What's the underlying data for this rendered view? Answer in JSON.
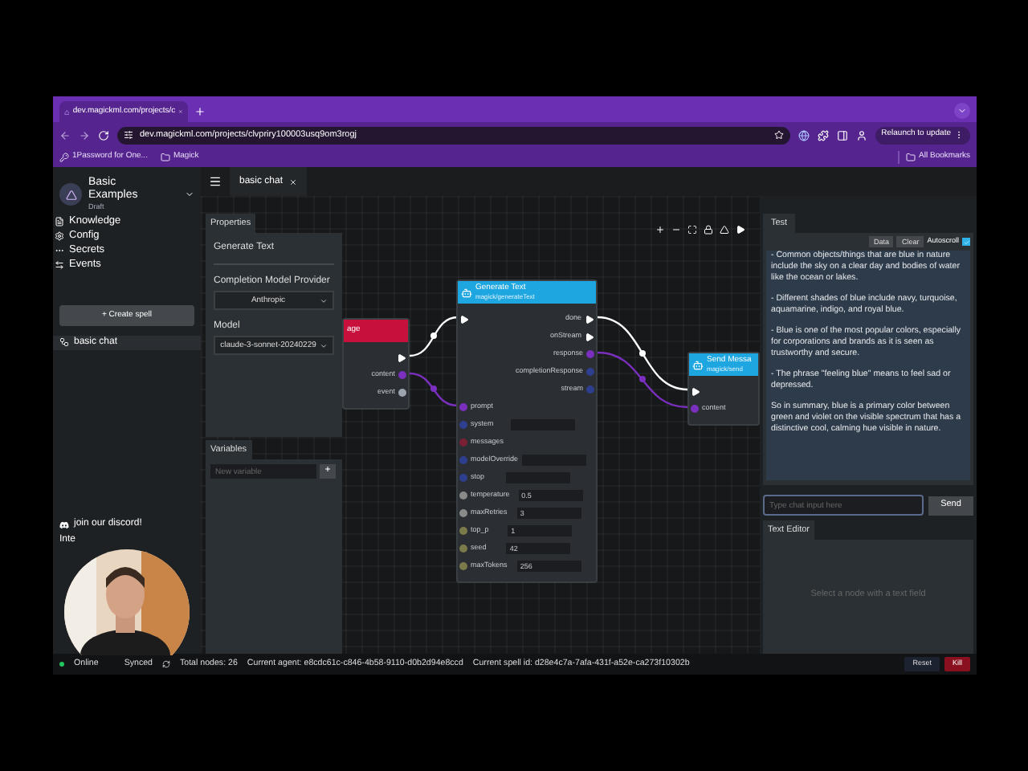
{
  "browser": {
    "tab_title": "dev.magickml.com/projects/c",
    "url": "dev.magickml.com/projects/clvpriry100003usq9om3rogj",
    "relaunch": "Relaunch to update",
    "bookmarks": [
      {
        "label": "1Password for One...",
        "kind": "site"
      },
      {
        "label": "Magick",
        "kind": "folder"
      }
    ],
    "all_bookmarks": "All Bookmarks"
  },
  "sidebar": {
    "project_title": "Basic Examples",
    "project_status": "Draft",
    "nav": [
      {
        "label": "Knowledge",
        "kind": "knowledge"
      },
      {
        "label": "Config",
        "kind": "config"
      },
      {
        "label": "Secrets",
        "kind": "secrets"
      },
      {
        "label": "Events",
        "kind": "events"
      }
    ],
    "create_button": "+ Create spell",
    "spells": [
      {
        "label": "basic chat",
        "selected": true
      }
    ],
    "footer": [
      {
        "label": "join our discord!",
        "kind": "discord"
      },
      {
        "label": "Inte",
        "kind": "plain"
      }
    ]
  },
  "editor_tabs": [
    {
      "label": "basic chat",
      "selected": true
    }
  ],
  "properties": {
    "tab": "Properties",
    "node_title": "Generate Text",
    "fields": [
      {
        "label": "Completion Model Provider",
        "value": "Anthropic"
      },
      {
        "label": "Model",
        "value": "claude-3-sonnet-20240229"
      }
    ]
  },
  "variables": {
    "tab": "Variables",
    "placeholder": "New variable",
    "add": "+"
  },
  "nodes": [
    {
      "title": "age",
      "color": "#c8103c",
      "rows": [
        {
          "out": {
            "kind": "exec"
          }
        },
        {
          "out": {
            "label": "content",
            "kind": "data",
            "color": "#7b2fbf"
          }
        },
        {
          "out": {
            "label": "event",
            "kind": "data",
            "color": "#9ca3af"
          }
        }
      ]
    },
    {
      "title": "Generate Text",
      "subtitle": "magick/generateText",
      "color": "#1ea6e0",
      "rows": [
        {
          "in": {
            "kind": "exec"
          },
          "out": {
            "label": "done",
            "kind": "exec"
          }
        },
        {
          "out": {
            "label": "onStream",
            "kind": "exec"
          }
        },
        {
          "out": {
            "label": "response",
            "kind": "data",
            "color": "#7b2fbf"
          }
        },
        {
          "out": {
            "label": "completionResponse",
            "kind": "data",
            "color": "#2f3f8f"
          }
        },
        {
          "out": {
            "label": "stream",
            "kind": "data",
            "color": "#2f3f8f"
          }
        },
        {
          "in": {
            "label": "prompt",
            "kind": "data",
            "color": "#7b2fbf"
          }
        },
        {
          "in": {
            "label": "system",
            "kind": "data",
            "color": "#2f3f8f"
          },
          "has_field": true
        },
        {
          "in": {
            "label": "messages",
            "kind": "data",
            "color": "#7a2034"
          }
        },
        {
          "in": {
            "label": "modelOverride",
            "kind": "data",
            "color": "#2f3f8f"
          },
          "has_field": true
        },
        {
          "in": {
            "label": "stop",
            "kind": "data",
            "color": "#2f3f8f"
          },
          "has_field": true
        },
        {
          "in": {
            "label": "temperature",
            "kind": "data",
            "color": "#8a8a8a"
          },
          "value": "0.5"
        },
        {
          "in": {
            "label": "maxRetries",
            "kind": "data",
            "color": "#8a8a8a"
          },
          "value": "3"
        },
        {
          "in": {
            "label": "top_p",
            "kind": "data",
            "color": "#7a7a4a"
          },
          "value": "1"
        },
        {
          "in": {
            "label": "seed",
            "kind": "data",
            "color": "#7a7a4a"
          },
          "value": "42"
        },
        {
          "in": {
            "label": "maxTokens",
            "kind": "data",
            "color": "#7a7a4a"
          },
          "value": "256"
        }
      ]
    },
    {
      "title": "Send Messa",
      "subtitle": "magick/send",
      "color": "#1ea6e0",
      "rows": [
        {
          "in": {
            "kind": "exec"
          }
        },
        {
          "in": {
            "label": "content",
            "kind": "data",
            "color": "#7b2fbf"
          }
        }
      ]
    }
  ],
  "test_panel": {
    "tab": "Test",
    "buttons": [
      "Data",
      "Clear"
    ],
    "autoscroll": {
      "label": "Autoscroll",
      "checked": true
    },
    "messages": [
      "- Common objects/things that are blue in nature include the sky on a clear day and bodies of water like the ocean or lakes.",
      "- Different shades of blue include navy, turquoise, aquamarine, indigo, and royal blue.",
      "- Blue is one of the most popular colors, especially for corporations and brands as it is seen as trustworthy and secure.",
      "- The phrase \"feeling blue\" means to feel sad or depressed.",
      "So in summary, blue is a primary color between green and violet on the visible spectrum that has a distinctive cool, calming hue visible in nature."
    ],
    "input_placeholder": "Type chat input here",
    "send": "Send"
  },
  "text_editor": {
    "tab": "Text Editor",
    "empty_message": "Select a node with a text field"
  },
  "status_bar": {
    "connection": {
      "label": "Online",
      "color": "#22c55e"
    },
    "sync": "Synced",
    "total_nodes": "Total nodes: 26",
    "agent": "Current agent: e8cdc61c-c846-4b58-9110-d0b2d94e8ccd",
    "spell": "Current spell id: d28e4c7a-7afa-431f-a52e-ca273f10302b",
    "buttons": [
      {
        "label": "Reset",
        "kind": "neutral"
      },
      {
        "label": "Kill",
        "kind": "danger"
      }
    ]
  }
}
